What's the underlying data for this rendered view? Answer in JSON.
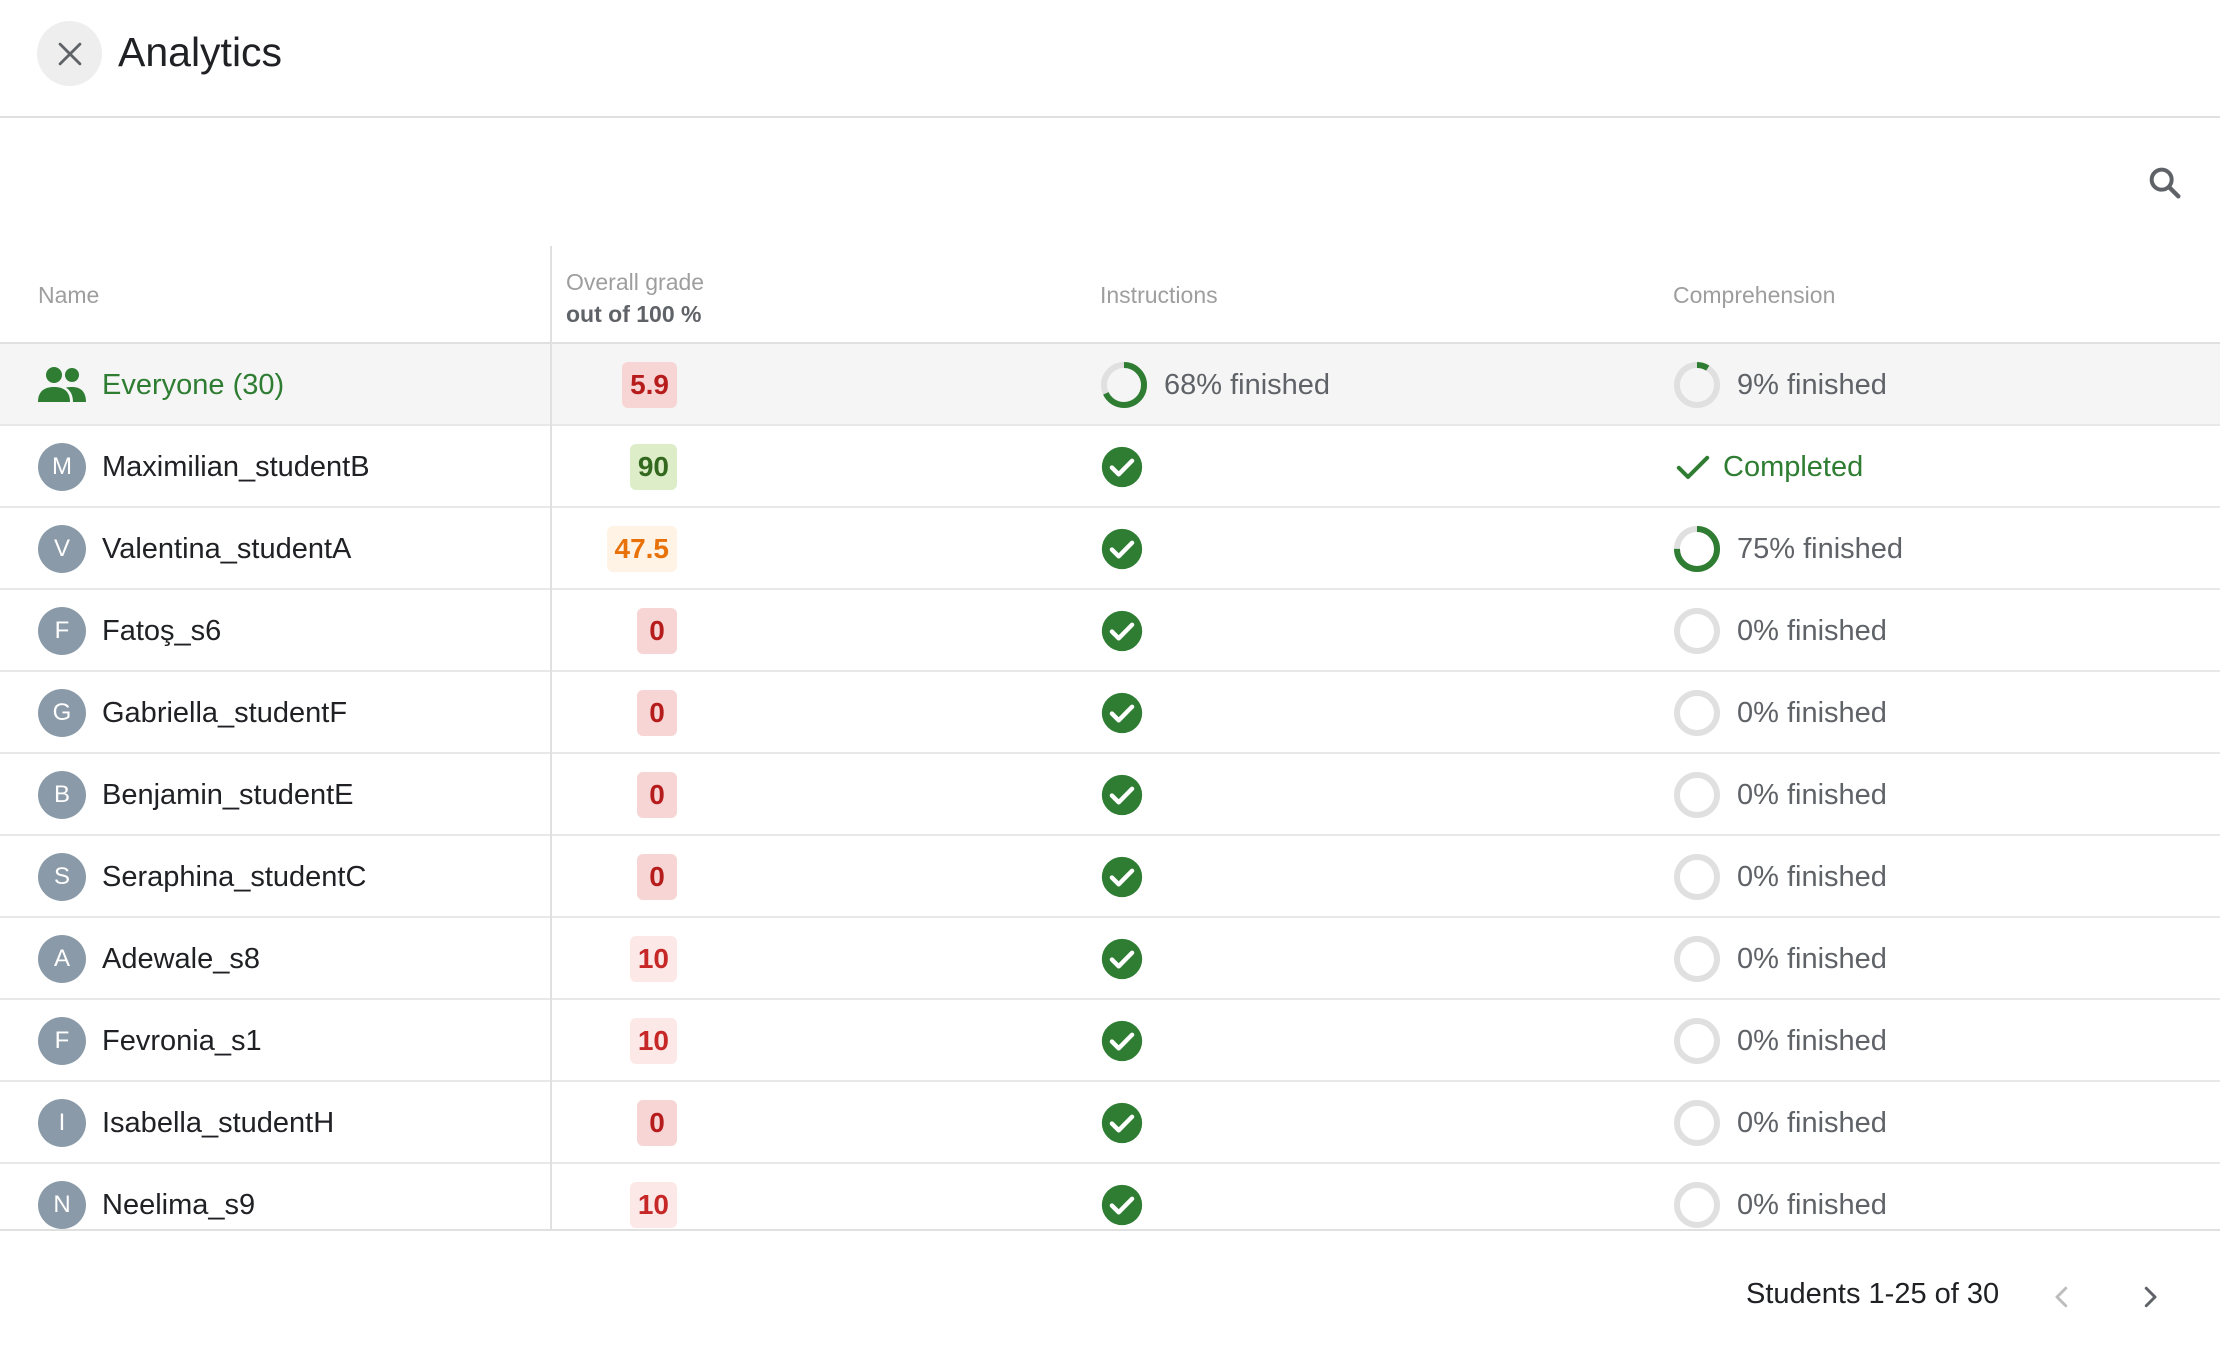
{
  "header": {
    "title": "Analytics"
  },
  "colors": {
    "accent": "#2e7d32",
    "avatar": "#8a9aa8",
    "ring_track": "#e0e0e0"
  },
  "table": {
    "columns": {
      "name": "Name",
      "grade_title": "Overall grade",
      "grade_sub": "out of 100 %",
      "instructions": "Instructions",
      "comprehension": "Comprehension"
    },
    "summary": {
      "name": "Everyone (30)",
      "grade": "5.9",
      "instructions": {
        "text": "68% finished",
        "progress": 0.68
      },
      "comprehension": {
        "text": "9% finished",
        "progress": 0.09
      }
    },
    "rows": [
      {
        "initial": "M",
        "name": "Maximilian_studentB",
        "grade": "90",
        "grade_level": "green",
        "instructions": "done",
        "comprehension": {
          "state": "completed",
          "text": "Completed"
        }
      },
      {
        "initial": "V",
        "name": "Valentina_studentA",
        "grade": "47.5",
        "grade_level": "orange",
        "instructions": "done",
        "comprehension": {
          "state": "progress",
          "text": "75% finished",
          "progress": 0.75
        }
      },
      {
        "initial": "F",
        "name": "Fatoş_s6",
        "grade": "0",
        "grade_level": "red",
        "instructions": "done",
        "comprehension": {
          "state": "progress",
          "text": "0% finished",
          "progress": 0
        }
      },
      {
        "initial": "G",
        "name": "Gabriella_studentF",
        "grade": "0",
        "grade_level": "red",
        "instructions": "done",
        "comprehension": {
          "state": "progress",
          "text": "0% finished",
          "progress": 0
        }
      },
      {
        "initial": "B",
        "name": "Benjamin_studentE",
        "grade": "0",
        "grade_level": "red",
        "instructions": "done",
        "comprehension": {
          "state": "progress",
          "text": "0% finished",
          "progress": 0
        }
      },
      {
        "initial": "S",
        "name": "Seraphina_studentC",
        "grade": "0",
        "grade_level": "red",
        "instructions": "done",
        "comprehension": {
          "state": "progress",
          "text": "0% finished",
          "progress": 0
        }
      },
      {
        "initial": "A",
        "name": "Adewale_s8",
        "grade": "10",
        "grade_level": "lightred",
        "instructions": "done",
        "comprehension": {
          "state": "progress",
          "text": "0% finished",
          "progress": 0
        }
      },
      {
        "initial": "F",
        "name": "Fevronia_s1",
        "grade": "10",
        "grade_level": "lightred",
        "instructions": "done",
        "comprehension": {
          "state": "progress",
          "text": "0% finished",
          "progress": 0
        }
      },
      {
        "initial": "I",
        "name": "Isabella_studentH",
        "grade": "0",
        "grade_level": "red",
        "instructions": "done",
        "comprehension": {
          "state": "progress",
          "text": "0% finished",
          "progress": 0
        }
      },
      {
        "initial": "N",
        "name": "Neelima_s9",
        "grade": "10",
        "grade_level": "lightred",
        "instructions": "done",
        "comprehension": {
          "state": "progress",
          "text": "0% finished",
          "progress": 0
        }
      }
    ]
  },
  "footer": {
    "range_label": "Students 1-25 of 30"
  },
  "icons": {
    "close": "close-icon",
    "search": "search-icon",
    "group": "group-icon",
    "done": "check-circle-icon",
    "completed": "check-icon",
    "prev": "chevron-left-icon",
    "next": "chevron-right-icon"
  }
}
